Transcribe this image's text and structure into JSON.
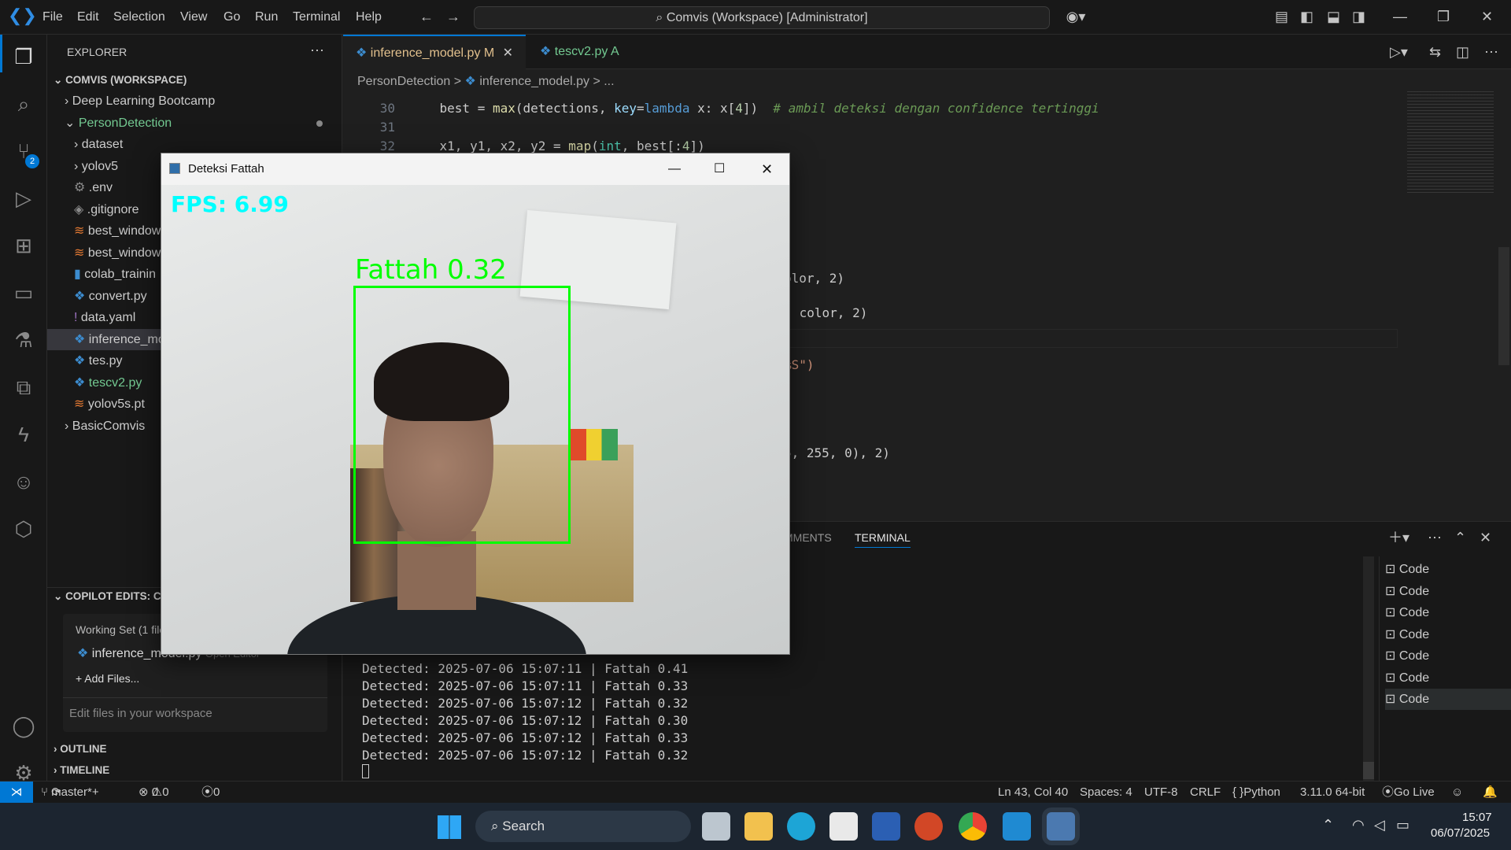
{
  "menu": [
    "File",
    "Edit",
    "Selection",
    "View",
    "Go",
    "Run",
    "Terminal",
    "Help"
  ],
  "command_center": "Comvis (Workspace) [Administrator]",
  "explorer": {
    "title": "EXPLORER",
    "workspace": "COMVIS (WORKSPACE)",
    "items": [
      {
        "label": "Deep Learning Bootcamp",
        "kind": "folder"
      },
      {
        "label": "PersonDetection",
        "kind": "folder-open"
      },
      {
        "label": "dataset",
        "kind": "folder"
      },
      {
        "label": "yolov5",
        "kind": "folder"
      },
      {
        "label": ".env",
        "kind": "gear"
      },
      {
        "label": ".gitignore",
        "kind": "git"
      },
      {
        "label": "best_window",
        "kind": "rss"
      },
      {
        "label": "best_window",
        "kind": "rss"
      },
      {
        "label": "colab_trainin",
        "kind": "nb"
      },
      {
        "label": "convert.py",
        "kind": "py"
      },
      {
        "label": "data.yaml",
        "kind": "yaml"
      },
      {
        "label": "inference_mo",
        "kind": "py"
      },
      {
        "label": "tes.py",
        "kind": "py"
      },
      {
        "label": "tescv2.py",
        "kind": "py"
      },
      {
        "label": "yolov5s.pt",
        "kind": "rss"
      },
      {
        "label": "BasicComvis",
        "kind": "folder"
      }
    ],
    "copilot": "COPILOT EDITS: CO",
    "working_set": "Working Set (1 file",
    "working_file": "inference_model.py",
    "working_file_hint": "Open Editor",
    "add_files": "+ Add Files...",
    "edit_placeholder": "Edit files in your workspace",
    "outline": "OUTLINE",
    "timeline": "TIMELINE"
  },
  "tabs": [
    {
      "label": "inference_model.py",
      "badge": "M"
    },
    {
      "label": "tescv2.py",
      "badge": "A"
    }
  ],
  "breadcrumb": [
    "PersonDetection",
    ">",
    "inference_model.py",
    ">",
    "..."
  ],
  "code": {
    "lines": [
      {
        "n": "30",
        "text": "    best = max(detections, key=lambda x: x[4])  # ambil deteksi dengan confidence tertinggi"
      },
      {
        "n": "31",
        "text": ""
      },
      {
        "n": "32",
        "text": "    x1, y1, x2, y2 = map(int, best[:4])"
      }
    ],
    "fragments": [
      "olor, 2)",
      " color, 2)",
      "%S\")",
      ",",
      "5, 255, 0), 2)"
    ]
  },
  "panel": {
    "tabs": [
      "MMENTS",
      "TERMINAL"
    ],
    "terminal_lines": [
      "Detected: 2025-07-06 15:07:11 | Fattah 0.41",
      "Detected: 2025-07-06 15:07:11 | Fattah 0.33",
      "Detected: 2025-07-06 15:07:12 | Fattah 0.32",
      "Detected: 2025-07-06 15:07:12 | Fattah 0.30",
      "Detected: 2025-07-06 15:07:12 | Fattah 0.33",
      "Detected: 2025-07-06 15:07:12 | Fattah 0.32"
    ],
    "terminal_items": [
      "Code",
      "Code",
      "Code",
      "Code",
      "Code",
      "Code",
      "Code"
    ]
  },
  "status": {
    "branch": "master*+",
    "errors": "0",
    "warnings": "0",
    "ports": "0",
    "position": "Ln 43, Col 40",
    "spaces": "Spaces: 4",
    "encoding": "UTF-8",
    "eol": "CRLF",
    "language": "Python",
    "interpreter": "3.11.0 64-bit",
    "golive": "Go Live"
  },
  "taskbar": {
    "search": "Search",
    "time": "15:07",
    "date": "06/07/2025"
  },
  "cv_window": {
    "title": "Deteksi Fattah",
    "fps": "FPS: 6.99",
    "label": "Fattah 0.32",
    "box_color": "#00ff00",
    "fps_color": "#00ffff"
  },
  "source_control_badge": "2"
}
